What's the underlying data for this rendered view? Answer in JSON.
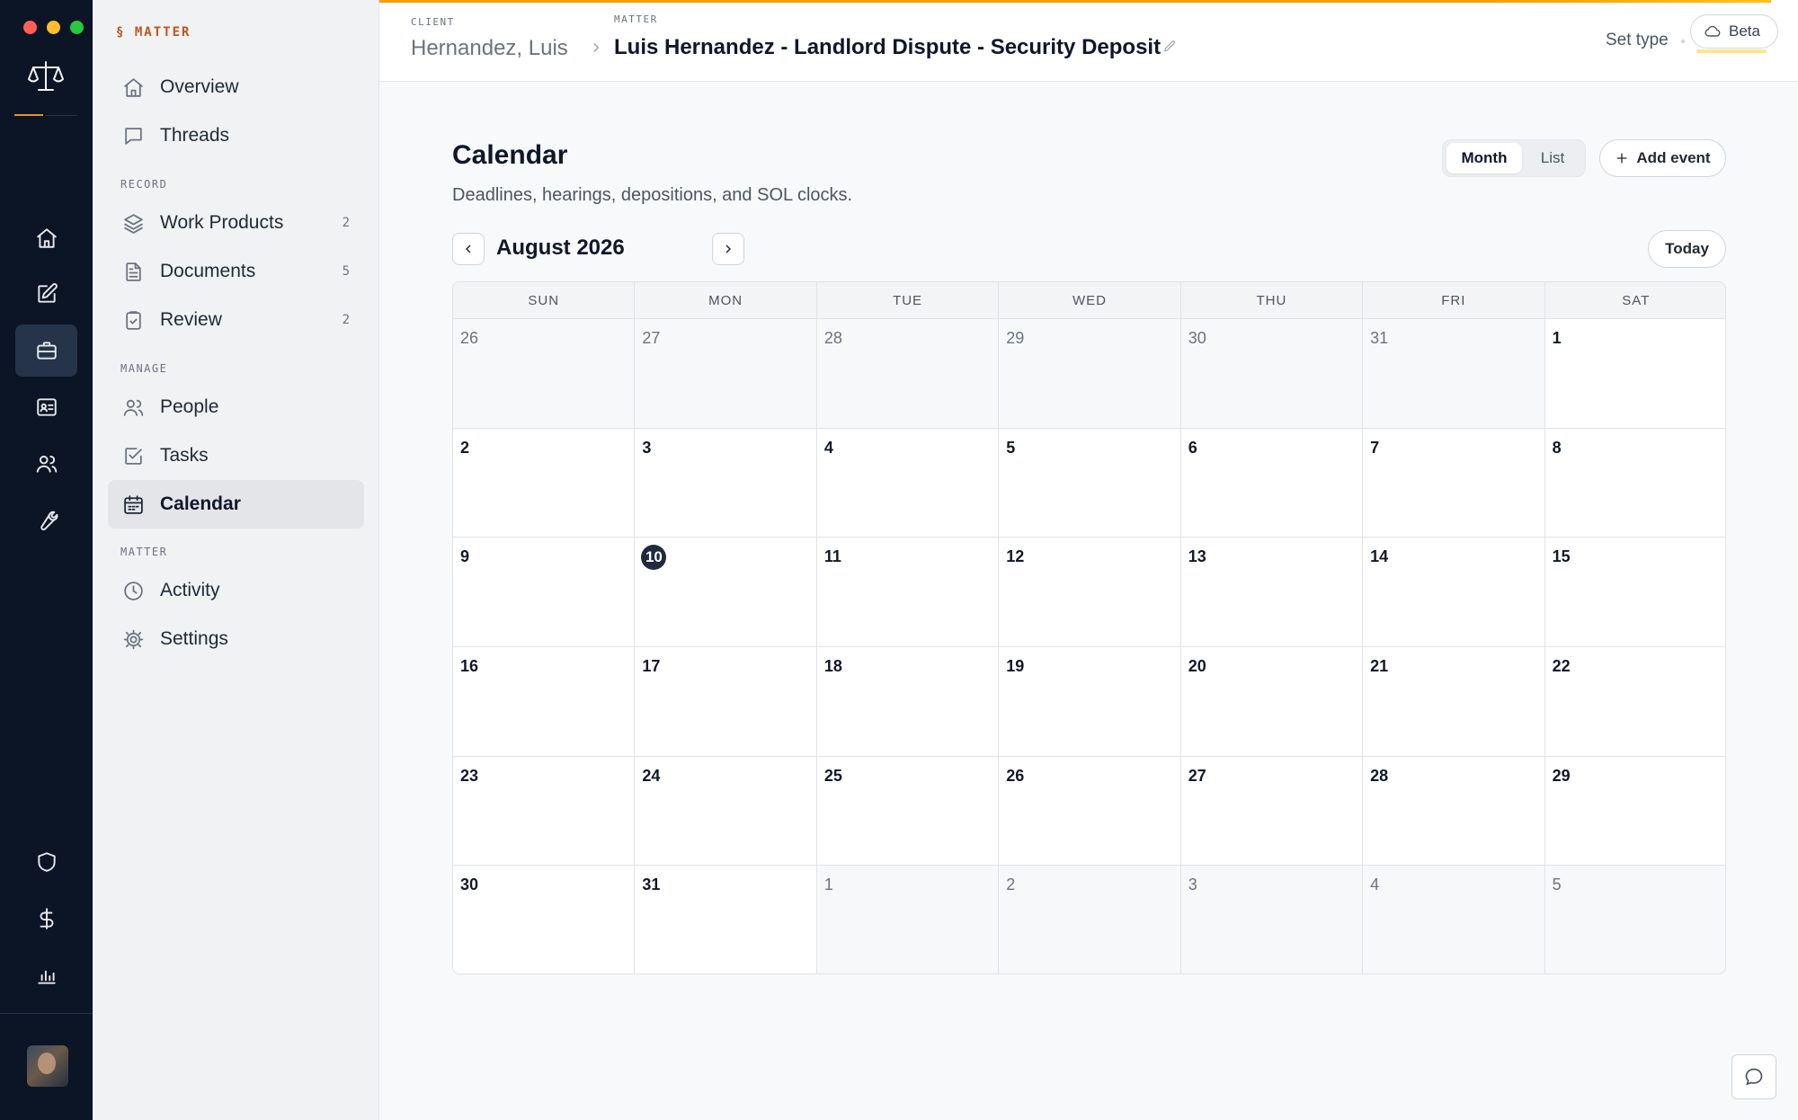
{
  "window": {
    "traffic_colors": [
      "#ff5f57",
      "#febc2e",
      "#28c840"
    ]
  },
  "rail": {
    "items": [
      "home-icon",
      "edit-icon",
      "briefcase-icon",
      "contact-card-icon",
      "users-icon",
      "wrench-icon",
      "shield-icon",
      "dollar-icon",
      "bar-chart-icon"
    ],
    "active": "briefcase-icon"
  },
  "nav": {
    "brand": "§ MATTER",
    "top_items": [
      {
        "label": "Overview",
        "icon": "home-icon"
      },
      {
        "label": "Threads",
        "icon": "chat-bubble-icon"
      }
    ],
    "record_section": "RECORD",
    "record_items": [
      {
        "label": "Work Products",
        "count": "2",
        "icon": "layers-icon"
      },
      {
        "label": "Documents",
        "count": "5",
        "icon": "document-icon"
      },
      {
        "label": "Review",
        "count": "2",
        "icon": "clipboard-check-icon"
      }
    ],
    "manage_section": "MANAGE",
    "manage_items": [
      {
        "label": "People",
        "icon": "users-icon"
      },
      {
        "label": "Tasks",
        "icon": "checkbox-icon"
      },
      {
        "label": "Calendar",
        "icon": "calendar-icon",
        "active": true
      }
    ],
    "matter_section": "MATTER",
    "matter_items": [
      {
        "label": "Activity",
        "icon": "clock-icon"
      },
      {
        "label": "Settings",
        "icon": "gear-icon"
      }
    ]
  },
  "header": {
    "client_label": "CLIENT",
    "client_name": "Hernandez, Luis",
    "matter_label": "MATTER",
    "matter_name": "Luis Hernandez - Landlord Dispute - Security Deposit",
    "set_type": "Set type",
    "beta": "Beta",
    "accent_color": "#f59e0b"
  },
  "calendar": {
    "title": "Calendar",
    "subtitle": "Deadlines, hearings, depositions, and SOL clocks.",
    "views": [
      "Month",
      "List"
    ],
    "active_view": "Month",
    "add_event": "Add event",
    "month_label": "August 2026",
    "today_button": "Today",
    "weekdays": [
      "SUN",
      "MON",
      "TUE",
      "WED",
      "THU",
      "FRI",
      "SAT"
    ],
    "today": "10",
    "days": [
      {
        "n": "26",
        "out": true
      },
      {
        "n": "27",
        "out": true
      },
      {
        "n": "28",
        "out": true
      },
      {
        "n": "29",
        "out": true
      },
      {
        "n": "30",
        "out": true
      },
      {
        "n": "31",
        "out": true
      },
      {
        "n": "1",
        "out": false
      },
      {
        "n": "2",
        "out": false
      },
      {
        "n": "3",
        "out": false
      },
      {
        "n": "4",
        "out": false
      },
      {
        "n": "5",
        "out": false
      },
      {
        "n": "6",
        "out": false
      },
      {
        "n": "7",
        "out": false
      },
      {
        "n": "8",
        "out": false
      },
      {
        "n": "9",
        "out": false
      },
      {
        "n": "10",
        "out": false,
        "today": true
      },
      {
        "n": "11",
        "out": false
      },
      {
        "n": "12",
        "out": false
      },
      {
        "n": "13",
        "out": false
      },
      {
        "n": "14",
        "out": false
      },
      {
        "n": "15",
        "out": false
      },
      {
        "n": "16",
        "out": false
      },
      {
        "n": "17",
        "out": false
      },
      {
        "n": "18",
        "out": false
      },
      {
        "n": "19",
        "out": false
      },
      {
        "n": "20",
        "out": false
      },
      {
        "n": "21",
        "out": false
      },
      {
        "n": "22",
        "out": false
      },
      {
        "n": "23",
        "out": false
      },
      {
        "n": "24",
        "out": false
      },
      {
        "n": "25",
        "out": false
      },
      {
        "n": "26",
        "out": false
      },
      {
        "n": "27",
        "out": false
      },
      {
        "n": "28",
        "out": false
      },
      {
        "n": "29",
        "out": false
      },
      {
        "n": "30",
        "out": false
      },
      {
        "n": "31",
        "out": false
      },
      {
        "n": "1",
        "out": true
      },
      {
        "n": "2",
        "out": true
      },
      {
        "n": "3",
        "out": true
      },
      {
        "n": "4",
        "out": true
      },
      {
        "n": "5",
        "out": true
      }
    ]
  }
}
